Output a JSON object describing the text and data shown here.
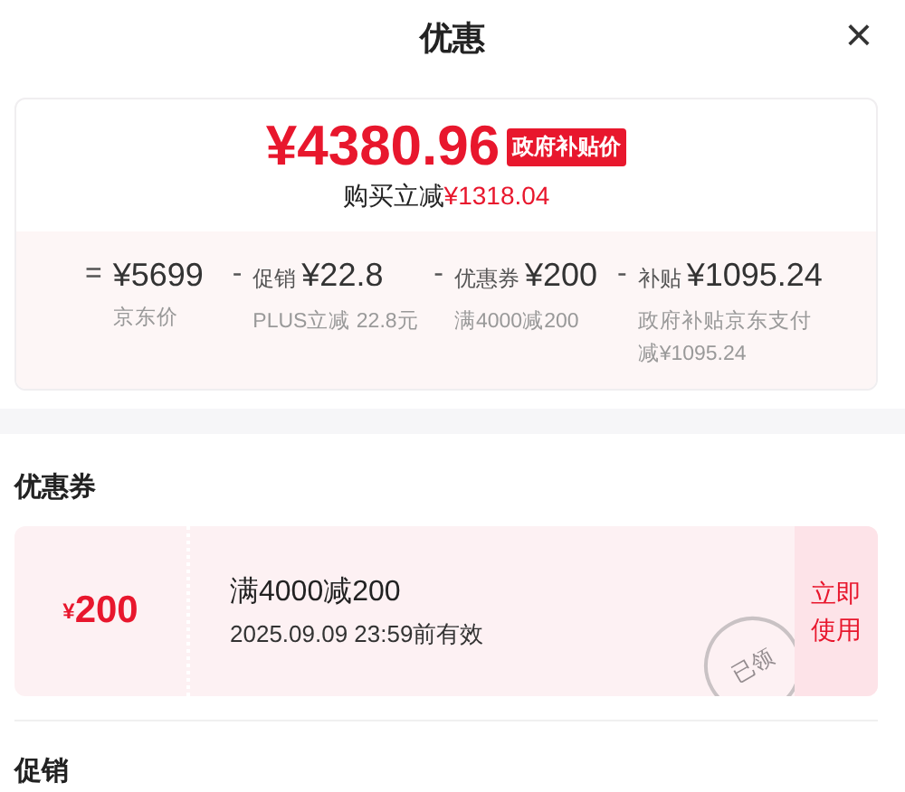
{
  "header": {
    "title": "优惠",
    "close": "×"
  },
  "price_card": {
    "price": "¥4380.96",
    "badge": "政府补贴价",
    "saving_label": "购买立减",
    "saving_amount": "¥1318.04",
    "breakdown": [
      {
        "operator": "=",
        "amount": "¥5699",
        "note": "京东价"
      },
      {
        "operator": "-",
        "label": "促销",
        "amount": "¥22.8",
        "note": "PLUS立减 22.8元"
      },
      {
        "operator": "-",
        "label": "优惠券",
        "amount": "¥200",
        "note": "满4000减200"
      },
      {
        "operator": "-",
        "label": "补贴",
        "amount": "¥1095.24",
        "note": "政府补贴京东支付减¥1095.24"
      }
    ]
  },
  "coupon_section": {
    "heading": "优惠券",
    "coupons": [
      {
        "currency": "¥",
        "value": "200",
        "condition": "满4000减200",
        "validity": "2025.09.09 23:59前有效",
        "action": "立即使用",
        "stamp": "已领"
      }
    ]
  },
  "promotion_section": {
    "heading": "促销"
  }
}
